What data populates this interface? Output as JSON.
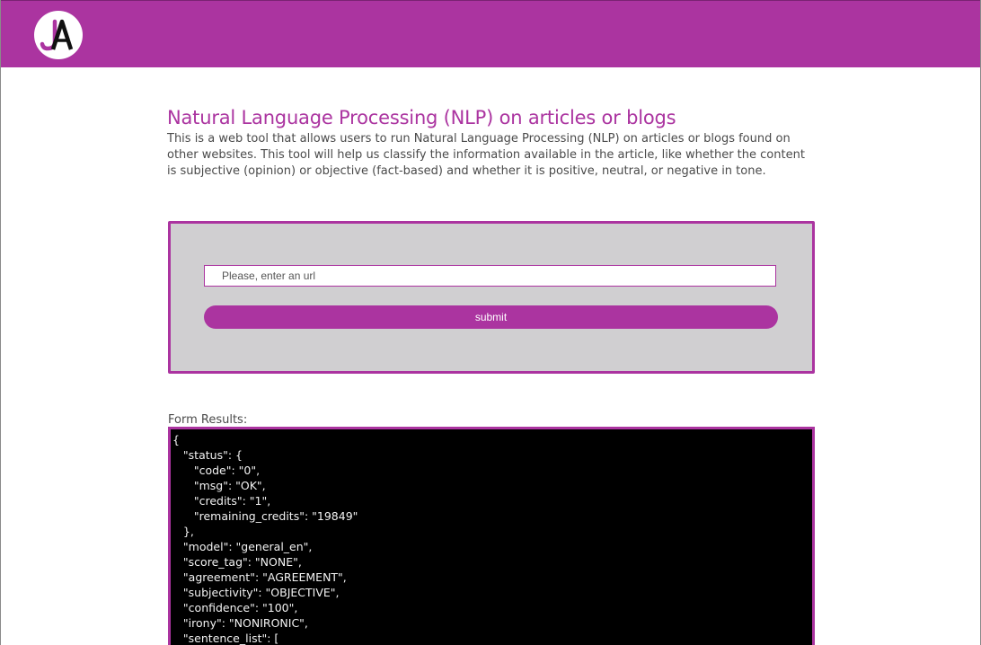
{
  "header": {
    "logo_text": "JA",
    "colors": {
      "brand": "#ab34a0",
      "form_bg": "#d0cfd1",
      "results_bg": "#000000"
    }
  },
  "main": {
    "title": "Natural Language Processing (NLP) on articles or blogs",
    "description": "This is a web tool that allows users to run Natural Language Processing (NLP) on articles or blogs found on other websites. This tool will help us classify the information available in the article, like whether the content is subjective (opinion) or objective (fact-based) and whether it is positive, neutral, or negative in tone."
  },
  "form": {
    "url_placeholder": "Please, enter an url",
    "url_value": "",
    "submit_label": "submit"
  },
  "results": {
    "label": "Form Results:",
    "lines": [
      "{",
      "   \"status\": {",
      "      \"code\": \"0\",",
      "      \"msg\": \"OK\",",
      "      \"credits\": \"1\",",
      "      \"remaining_credits\": \"19849\"",
      "   },",
      "   \"model\": \"general_en\",",
      "   \"score_tag\": \"NONE\",",
      "   \"agreement\": \"AGREEMENT\",",
      "   \"subjectivity\": \"OBJECTIVE\",",
      "   \"confidence\": \"100\",",
      "   \"irony\": \"NONIRONIC\",",
      "   \"sentence_list\": ["
    ]
  }
}
